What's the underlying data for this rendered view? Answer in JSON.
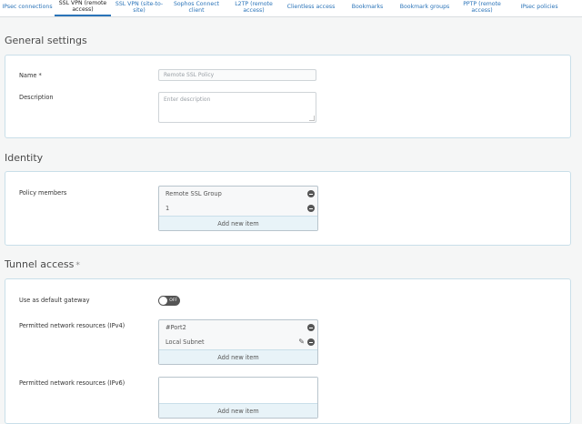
{
  "tabs": [
    {
      "label": "IPsec connections",
      "active": false
    },
    {
      "label": "SSL VPN (remote access)",
      "active": true
    },
    {
      "label": "SSL VPN (site-to-site)",
      "active": false
    },
    {
      "label": "Sophos Connect client",
      "active": false
    },
    {
      "label": "L2TP (remote access)",
      "active": false
    },
    {
      "label": "Clientless access",
      "active": false
    },
    {
      "label": "Bookmarks",
      "active": false
    },
    {
      "label": "Bookmark groups",
      "active": false
    },
    {
      "label": "PPTP (remote access)",
      "active": false
    },
    {
      "label": "IPsec policies",
      "active": false
    }
  ],
  "general": {
    "title": "General settings",
    "name_label": "Name *",
    "name_value": "Remote SSL Policy",
    "description_label": "Description",
    "description_placeholder": "Enter description"
  },
  "identity": {
    "title": "Identity",
    "members_label": "Policy members",
    "members": [
      "Remote SSL Group",
      "1"
    ],
    "add_label": "Add new item"
  },
  "tunnel": {
    "title": "Tunnel access",
    "required_mark": "*",
    "gateway_label": "Use as default gateway",
    "gateway_toggle": "OFF",
    "ipv4_label": "Permitted network resources (IPv4)",
    "ipv4_items": [
      "#Port2",
      "Local Subnet"
    ],
    "ipv4_add_label": "Add new item",
    "ipv6_label": "Permitted network resources (IPv6)",
    "ipv6_add_label": "Add new item"
  }
}
